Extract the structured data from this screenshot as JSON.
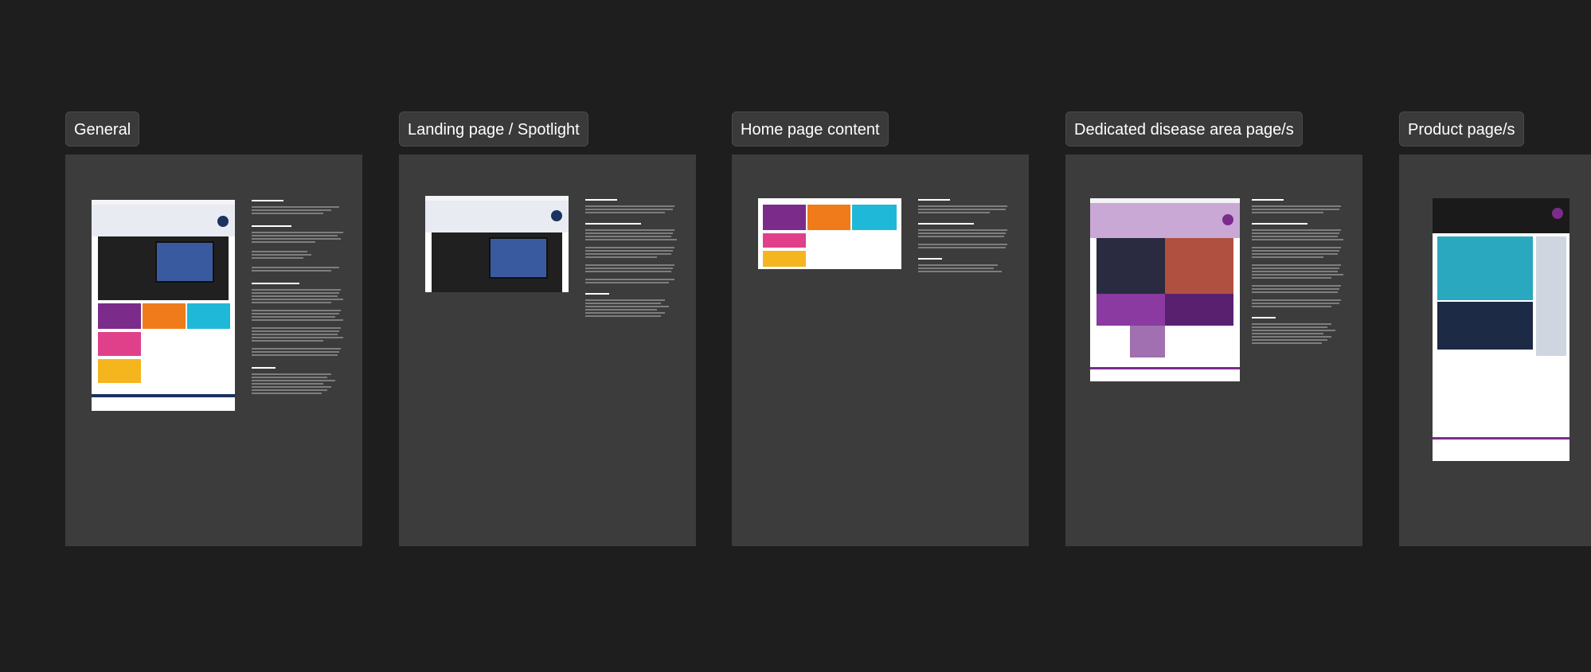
{
  "frames": [
    {
      "label": "General"
    },
    {
      "label": "Landing page / Spotlight"
    },
    {
      "label": "Home page content"
    },
    {
      "label": "Dedicated disease area page/s"
    },
    {
      "label": "Product page/s"
    }
  ],
  "colors": {
    "canvas": "#1e1e1e",
    "frame": "#3c3c3c",
    "label_bg": "#3a3a3a",
    "purple": "#7b2c8b",
    "orange": "#f07b1a",
    "cyan": "#20b8d8",
    "pink": "#e0408a",
    "yellow": "#f5b51e",
    "navy": "#1c3260"
  }
}
